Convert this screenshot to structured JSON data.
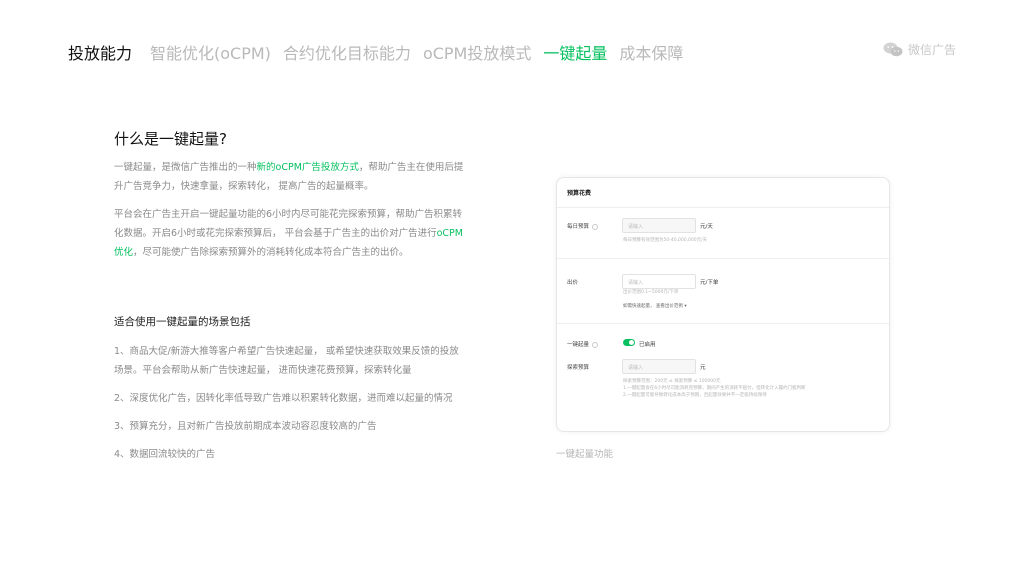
{
  "nav": {
    "lead": "投放能力",
    "tabs": [
      {
        "label": "智能优化(oCPM)",
        "active": false
      },
      {
        "label": "合约优化目标能力",
        "active": false
      },
      {
        "label": "oCPM投放模式",
        "active": false
      },
      {
        "label": "一键起量",
        "active": true
      },
      {
        "label": "成本保障",
        "active": false
      }
    ]
  },
  "brand": {
    "name": "微信广告",
    "icon": "wechat-icon"
  },
  "intro": {
    "title": "什么是一键起量?",
    "p1_a": "一键起量，是微信广告推出的一种",
    "p1_hl": "新的oCPM广告投放方式",
    "p1_b": "，帮助广告主在使用后提升广告竞争力，快速拿量，探索转化，  提高广告的起量概率。",
    "p2_a": "平台会在广告主开启一键起量功能的6小时内尽可能花完探索预算，帮助广告积累转化数据。开启6小时或花完探索预算后，  平台会基于广告主的出价对广告进行",
    "p2_hl": "oCPM优化",
    "p2_b": "，尽可能使广告除探索预算外的消耗转化成本符合广告主的出价。"
  },
  "scenarios": {
    "title": "适合使用一键起量的场景包括",
    "items": [
      "1、商品大促/新游大推等客户希望广告快速起量，  或希望快速获取效果反馈的投放场景。平台会帮助从新广告快速起量，  进而快速花费预算，探索转化量",
      "2、深度优化广告，因转化率低导致广告难以积累转化数据，进而难以起量的情况",
      "3、预算充分，且对新广告投放前期成本波动容忍度较高的广告",
      "4、数据回流较快的广告"
    ]
  },
  "panel": {
    "title": "预算花费",
    "daily_budget_label": "每日预算",
    "daily_budget_placeholder": "请输入",
    "daily_budget_unit": "元/天",
    "daily_budget_tip": "每日预算有效范围为50-40,000,000元/天",
    "bid_label": "出价",
    "bid_placeholder": "请输入",
    "bid_unit": "元/下单",
    "bid_tip": "出价范围0.1~5000元/下单",
    "bid_link": "如需快速起量，  查看出价范例 ▾",
    "boost_label": "一键起量",
    "boost_status": "已启用",
    "explore_label": "探索预算",
    "explore_placeholder": "请输入",
    "explore_unit": "元",
    "explore_tip1": "探索预算范围：200元 ≤ 探索预算 ≤ 100000元",
    "explore_tip2": "1.一键起量会在6小时尽可能消耗完预算，期间产生的消耗不赔付，但转化计入履约门槛判断",
    "explore_tip3": "2.一键起量可能导致转化成本高于预期，且起量效果并不一定能持续保持"
  },
  "caption": "一键起量功能",
  "colors": {
    "accent": "#07c160",
    "muted": "#8a8a8a"
  }
}
